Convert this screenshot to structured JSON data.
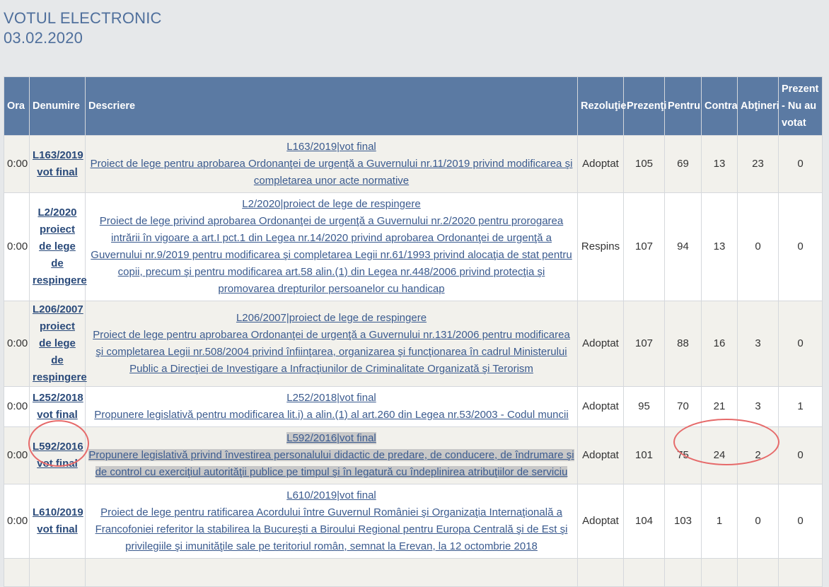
{
  "header": {
    "title": "VOTUL ELECTRONIC",
    "date": "03.02.2020"
  },
  "columns": {
    "ora": "Ora",
    "denumire": "Denumire",
    "descriere": "Descriere",
    "rezolutie": "Rezoluţie",
    "prezenti": "Prezenţi",
    "pentru": "Pentru",
    "contra": "Contra",
    "abtineri": "Abţineri",
    "prezent_nu_au_votat": "Prezent - Nu au votat"
  },
  "rows": [
    {
      "ora": "0:00",
      "denumire": "L163/2019 vot final",
      "desc_title": "L163/2019|vot final",
      "desc_text": "Proiect de lege pentru aprobarea Ordonanţei de urgenţă a Guvernului nr.11/2019 privind modificarea şi completarea unor acte normative",
      "rezolutie": "Adoptat",
      "prezenti": "105",
      "pentru": "69",
      "contra": "13",
      "abtineri": "23",
      "nu_au_votat": "0"
    },
    {
      "ora": "0:00",
      "denumire": "L2/2020 proiect de lege de respingere",
      "desc_title": "L2/2020|proiect de lege de respingere",
      "desc_text": "Proiect de lege privind aprobarea Ordonanţei de urgenţă a Guvernului nr.2/2020 pentru prorogarea intrării în vigoare a art.I pct.1 din Legea nr.14/2020 privind aprobarea Ordonanţei de urgenţă a Guvernului nr.9/2019 pentru modificarea şi completarea Legii nr.61/1993 privind alocaţia de stat pentru copii, precum şi pentru modificarea art.58 alin.(1) din Legea nr.448/2006 privind protecţia şi promovarea drepturilor persoanelor cu handicap",
      "rezolutie": "Respins",
      "prezenti": "107",
      "pentru": "94",
      "contra": "13",
      "abtineri": "0",
      "nu_au_votat": "0"
    },
    {
      "ora": "0:00",
      "denumire": "L206/2007 proiect de lege de respingere",
      "desc_title": "L206/2007|proiect de lege de respingere",
      "desc_text": "Proiect de lege pentru aprobarea Ordonanţei de urgenţă a Guvernului nr.131/2006 pentru modificarea şi completarea Legii nr.508/2004 privind înfiinţarea, organizarea şi funcţionarea în cadrul Ministerului Public a Direcţiei de Investigare a Infracţiunilor de Criminalitate Organizată şi Terorism",
      "rezolutie": "Adoptat",
      "prezenti": "107",
      "pentru": "88",
      "contra": "16",
      "abtineri": "3",
      "nu_au_votat": "0"
    },
    {
      "ora": "0:00",
      "denumire": "L252/2018 vot final",
      "desc_title": "L252/2018|vot final",
      "desc_text": "Propunere legislativă pentru modificarea lit.i) a alin.(1) al art.260 din Legea nr.53/2003 - Codul muncii",
      "rezolutie": "Adoptat",
      "prezenti": "95",
      "pentru": "70",
      "contra": "21",
      "abtineri": "3",
      "nu_au_votat": "1"
    },
    {
      "ora": "0:00",
      "denumire": "L592/2016 vot final",
      "desc_title": "L592/2016|vot final",
      "desc_text": "Propunere legislativă privind învestirea personalului didactic de predare, de conducere, de îndrumare şi de control cu exerciţiul autorităţii publice pe timpul şi în legatură cu îndeplinirea atribuţiilor de serviciu",
      "rezolutie": "Adoptat",
      "prezenti": "101",
      "pentru": "75",
      "contra": "24",
      "abtineri": "2",
      "nu_au_votat": "0"
    },
    {
      "ora": "0:00",
      "denumire": "L610/2019 vot final",
      "desc_title": "L610/2019|vot final",
      "desc_text": "Proiect de lege pentru ratificarea Acordului între Guvernul României şi Organizaţia Internaţională a Francofoniei referitor la stabilirea la Bucureşti a Biroului Regional pentru Europa Centrală şi de Est şi privilegiile şi imunităţile sale pe teritoriul român, semnat la Erevan, la 12 octombrie 2018",
      "rezolutie": "Adoptat",
      "prezenti": "104",
      "pentru": "103",
      "contra": "1",
      "abtineri": "0",
      "nu_au_votat": "0"
    }
  ],
  "annotations": {
    "color": "#e66a6a",
    "circled": [
      "denumire of row L592/2016",
      "pentru/contra/abtineri of row L592/2016"
    ]
  }
}
